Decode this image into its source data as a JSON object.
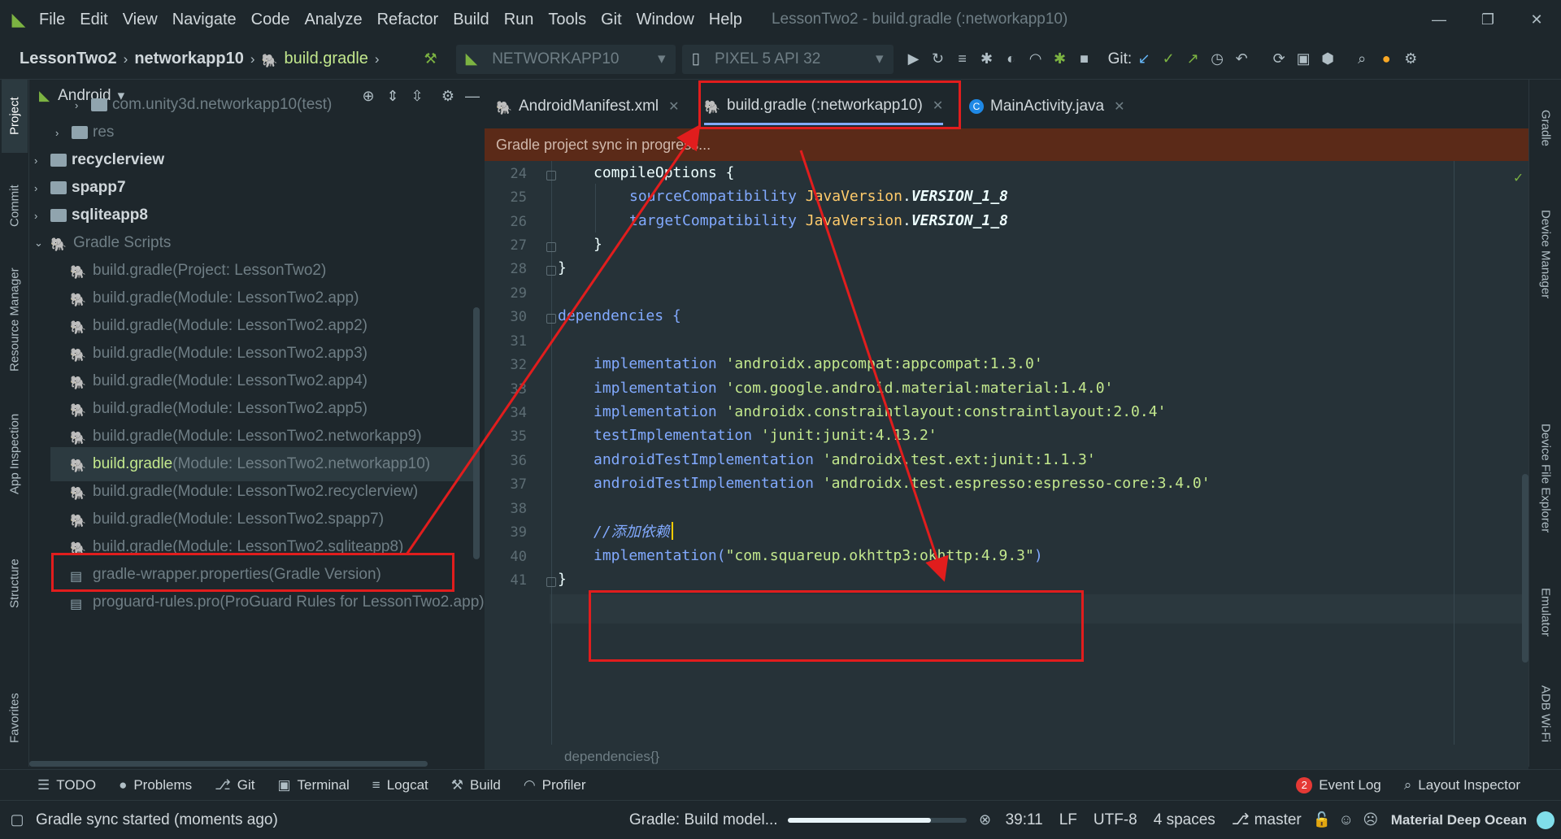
{
  "menu": {
    "items": [
      "File",
      "Edit",
      "View",
      "Navigate",
      "Code",
      "Analyze",
      "Refactor",
      "Build",
      "Run",
      "Tools",
      "Git",
      "Window",
      "Help"
    ],
    "window_title": "LessonTwo2 - build.gradle (:networkapp10)"
  },
  "navbar": {
    "breadcrumb": [
      "LessonTwo2",
      "networkapp10",
      "build.gradle"
    ],
    "run_config": "NETWORKAPP10",
    "device": "PIXEL 5 API 32",
    "git_label": "Git:"
  },
  "left_strip": {
    "tabs": [
      "Project",
      "Commit",
      "Resource Manager",
      "App Inspection",
      "Structure",
      "Favorites"
    ]
  },
  "right_strip": {
    "tabs": [
      "Gradle",
      "Device Manager",
      "Device File Explorer",
      "Emulator",
      "ADB Wi-Fi"
    ]
  },
  "project": {
    "view_mode": "Android",
    "items": [
      {
        "label": "com.unity3d.networkapp10",
        "suffix": " (test)"
      },
      {
        "label": "res",
        "suffix": ""
      },
      {
        "label": "recyclerview",
        "suffix": ""
      },
      {
        "label": "spapp7",
        "suffix": ""
      },
      {
        "label": "sqliteapp8",
        "suffix": ""
      },
      {
        "label": "Gradle Scripts",
        "suffix": ""
      },
      {
        "label": "build.gradle",
        "suffix": " (Project: LessonTwo2)"
      },
      {
        "label": "build.gradle",
        "suffix": " (Module: LessonTwo2.app)"
      },
      {
        "label": "build.gradle",
        "suffix": " (Module: LessonTwo2.app2)"
      },
      {
        "label": "build.gradle",
        "suffix": " (Module: LessonTwo2.app3)"
      },
      {
        "label": "build.gradle",
        "suffix": " (Module: LessonTwo2.app4)"
      },
      {
        "label": "build.gradle",
        "suffix": " (Module: LessonTwo2.app5)"
      },
      {
        "label": "build.gradle",
        "suffix": " (Module: LessonTwo2.networkapp9)"
      },
      {
        "label": "build.gradle",
        "suffix": " (Module: LessonTwo2.networkapp10)"
      },
      {
        "label": "build.gradle",
        "suffix": " (Module: LessonTwo2.recyclerview)"
      },
      {
        "label": "build.gradle",
        "suffix": " (Module: LessonTwo2.spapp7)"
      },
      {
        "label": "build.gradle",
        "suffix": " (Module: LessonTwo2.sqliteapp8)"
      },
      {
        "label": "gradle-wrapper.properties",
        "suffix": " (Gradle Version)"
      },
      {
        "label": "proguard-rules.pro",
        "suffix": " (ProGuard Rules for LessonTwo2.app)"
      }
    ]
  },
  "editor": {
    "tabs": [
      {
        "label": "AndroidManifest.xml"
      },
      {
        "label": "build.gradle (:networkapp10)"
      },
      {
        "label": "MainActivity.java"
      }
    ],
    "banner": "Gradle project sync in progress...",
    "line_numbers": [
      "24",
      "25",
      "26",
      "27",
      "28",
      "29",
      "30",
      "31",
      "32",
      "33",
      "34",
      "35",
      "36",
      "37",
      "38",
      "39",
      "40",
      "41"
    ],
    "code": {
      "l24": "compileOptions {",
      "l25a": "sourceCompatibility ",
      "l25b": "JavaVersion",
      "l25c": ".",
      "l25d": "VERSION_1_8",
      "l26a": "targetCompatibility ",
      "l26b": "JavaVersion",
      "l26c": ".",
      "l26d": "VERSION_1_8",
      "l27": "}",
      "l28": "}",
      "l30": "dependencies {",
      "l32a": "implementation ",
      "l32b": "'androidx.appcompat:appcompat:1.3.0'",
      "l33a": "implementation ",
      "l33b": "'com.google.android.material:material:1.4.0'",
      "l34a": "implementation ",
      "l34b": "'androidx.constraintlayout:constraintlayout:2.0.4'",
      "l35a": "testImplementation ",
      "l35b": "'junit:junit:4.13.2'",
      "l36a": "androidTestImplementation ",
      "l36b": "'androidx.test.ext:junit:1.1.3'",
      "l37a": "androidTestImplementation ",
      "l37b": "'androidx.test.espresso:espresso-core:3.4.0'",
      "l39": "//添加依赖",
      "l40a": "implementation(",
      "l40b": "\"com.squareup.okhttp3:okhttp:4.9.3\"",
      "l40c": ")",
      "l41": "}"
    },
    "breadcrumb": "dependencies{}"
  },
  "toolbar_bottom": {
    "items": [
      "TODO",
      "Problems",
      "Git",
      "Terminal",
      "Logcat",
      "Build",
      "Profiler"
    ],
    "event_log_count": "2",
    "event_log": "Event Log",
    "layout_inspector": "Layout Inspector"
  },
  "status": {
    "message": "Gradle sync started (moments ago)",
    "task": "Gradle: Build model...",
    "progress": 0.8,
    "caret": "39:11",
    "line_sep": "LF",
    "encoding": "UTF-8",
    "indent": "4 spaces",
    "branch": "master",
    "theme": "Material Deep Ocean"
  },
  "colors": {
    "annotation": "#e11d1d",
    "banner_bg": "#5b2a18",
    "highlight_green": "#c3e88d",
    "keyword_blue": "#82aaff"
  }
}
